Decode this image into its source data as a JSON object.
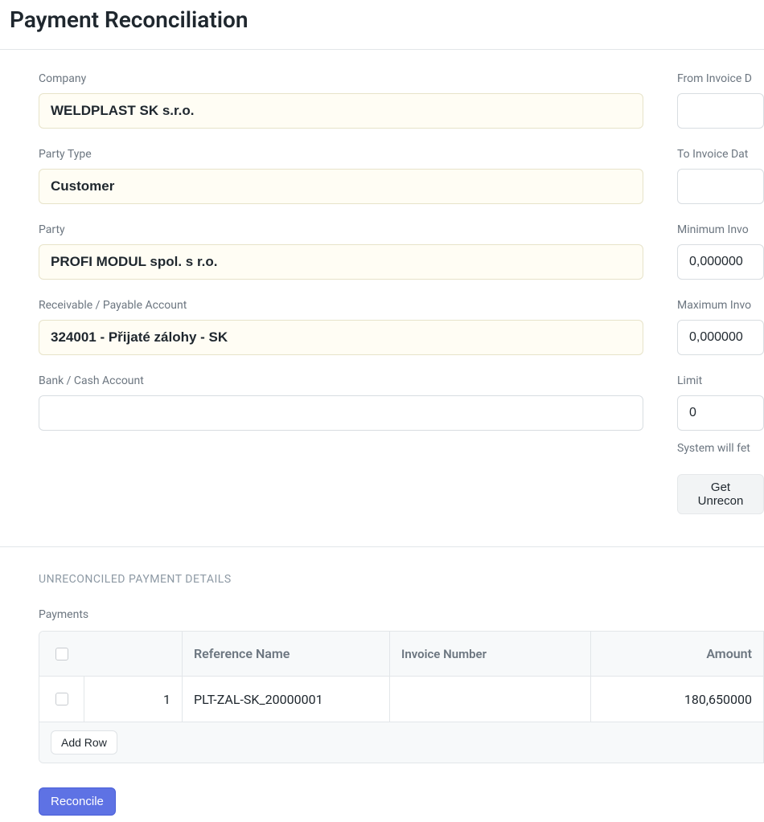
{
  "page_title": "Payment Reconciliation",
  "left_fields": {
    "company": {
      "label": "Company",
      "value": "WELDPLAST SK s.r.o."
    },
    "party_type": {
      "label": "Party Type",
      "value": "Customer"
    },
    "party": {
      "label": "Party",
      "value": "PROFI MODUL spol. s r.o."
    },
    "account": {
      "label": "Receivable / Payable Account",
      "value": "324001 - Přijaté zálohy - SK"
    },
    "bank": {
      "label": "Bank / Cash Account",
      "value": ""
    }
  },
  "right_fields": {
    "from_date": {
      "label": "From Invoice D",
      "value": ""
    },
    "to_date": {
      "label": "To Invoice Dat",
      "value": ""
    },
    "min_amt": {
      "label": "Minimum Invo",
      "value": "0,000000"
    },
    "max_amt": {
      "label": "Maximum Invo",
      "value": "0,000000"
    },
    "limit": {
      "label": "Limit",
      "value": "0"
    }
  },
  "help_text": "System will fet",
  "get_unreconciled_label": "Get Unrecon",
  "section_heading": "UNRECONCILED PAYMENT DETAILS",
  "table": {
    "label": "Payments",
    "columns": {
      "ref": "Reference Name",
      "inv": "Invoice Number",
      "amt": "Amount"
    },
    "rows": [
      {
        "idx": "1",
        "ref": "PLT-ZAL-SK_20000001",
        "inv": "",
        "amt": "180,650000"
      }
    ],
    "add_row_label": "Add Row"
  },
  "reconcile_label": "Reconcile"
}
